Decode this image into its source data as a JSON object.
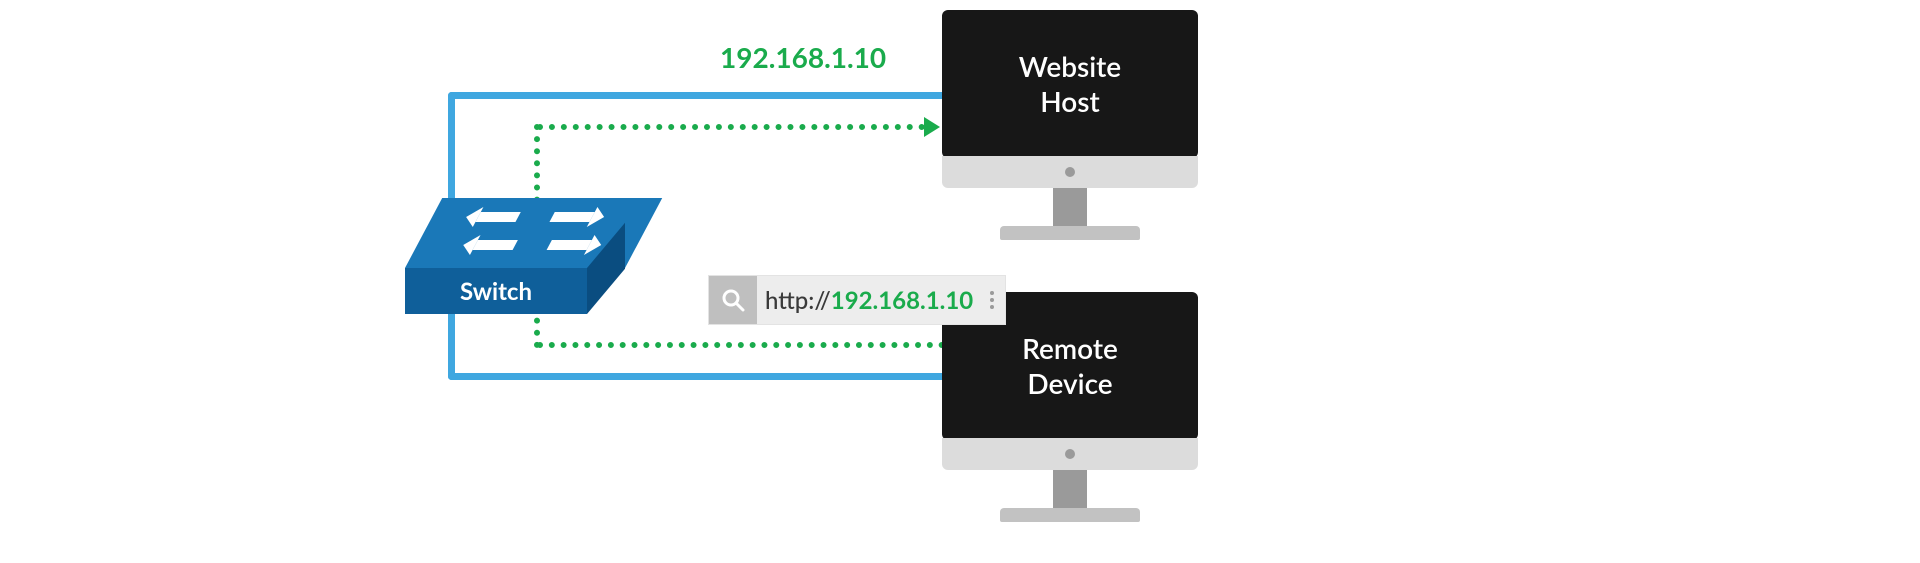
{
  "colors": {
    "connection": "#3fa7e0",
    "data_flow": "#1aab4c",
    "switch_top": "#1a78b8",
    "switch_front": "#0f5f9a",
    "switch_side": "#0a4d80",
    "monitor_screen": "#171717",
    "monitor_chin": "#dcdcdc",
    "addressbar_bg": "#ededed",
    "search_btn_bg": "#bfbfbf"
  },
  "switch": {
    "label": "Switch"
  },
  "hosts": {
    "website_host": {
      "line1": "Website",
      "line2": "Host",
      "ip": "192.168.1.10"
    },
    "remote_device": {
      "line1": "Remote",
      "line2": "Device"
    }
  },
  "addressbar": {
    "scheme": "http://",
    "ip": "192.168.1.10"
  }
}
